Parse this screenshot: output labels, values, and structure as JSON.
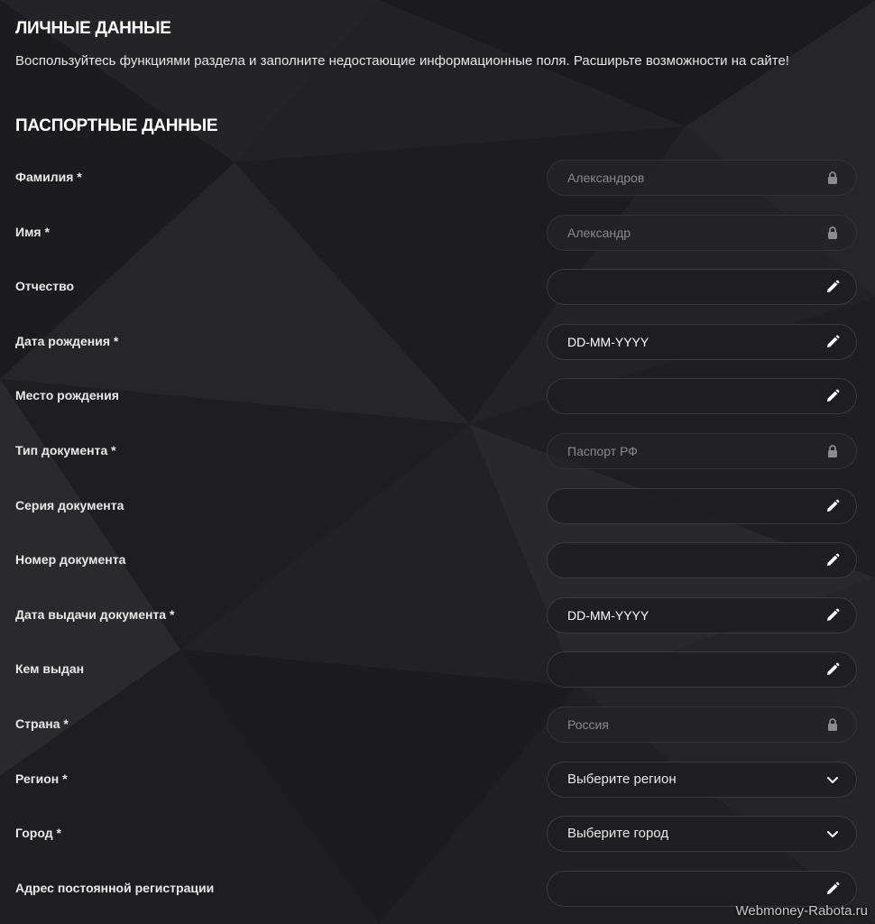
{
  "header": {
    "title": "ЛИЧНЫЕ ДАННЫЕ",
    "description": "Воспользуйтесь функциями раздела и заполните недостающие информационные поля. Расширьте возможности на сайте!"
  },
  "section": {
    "title": "ПАСПОРТНЫЕ ДАННЫЕ"
  },
  "fields": [
    {
      "label": "Фамилия *",
      "value": "Александров",
      "kind": "locked",
      "icon": "lock-icon"
    },
    {
      "label": "Имя *",
      "value": "Александр",
      "kind": "locked",
      "icon": "lock-icon"
    },
    {
      "label": "Отчество",
      "value": "",
      "kind": "editable",
      "icon": "pencil-icon"
    },
    {
      "label": "Дата рождения *",
      "value": "DD-MM-YYYY",
      "kind": "editable",
      "icon": "pencil-icon"
    },
    {
      "label": "Место рождения",
      "value": "",
      "kind": "editable",
      "icon": "pencil-icon"
    },
    {
      "label": "Тип документа *",
      "value": "Паспорт РФ",
      "kind": "locked",
      "icon": "lock-icon"
    },
    {
      "label": "Серия документа",
      "value": "",
      "kind": "editable",
      "icon": "pencil-icon"
    },
    {
      "label": "Номер документа",
      "value": "",
      "kind": "editable",
      "icon": "pencil-icon"
    },
    {
      "label": "Дата выдачи документа *",
      "value": "DD-MM-YYYY",
      "kind": "editable",
      "icon": "pencil-icon"
    },
    {
      "label": "Кем выдан",
      "value": "",
      "kind": "editable",
      "icon": "pencil-icon"
    },
    {
      "label": "Страна *",
      "value": "Россия",
      "kind": "locked",
      "icon": "lock-icon"
    },
    {
      "label": "Регион *",
      "value": "Выберите регион",
      "kind": "select",
      "icon": "chevron-down-icon"
    },
    {
      "label": "Город *",
      "value": "Выберите город",
      "kind": "select",
      "icon": "chevron-down-icon"
    },
    {
      "label": "Адрес постоянной регистрации",
      "value": "",
      "kind": "editable",
      "icon": "pencil-icon"
    }
  ],
  "watermark": "Webmoney-Rabota.ru"
}
